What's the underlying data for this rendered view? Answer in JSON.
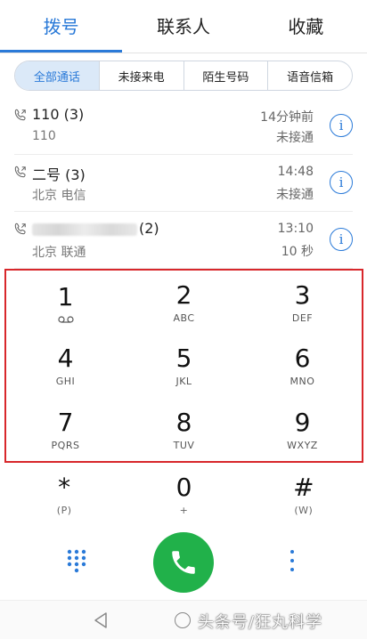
{
  "tabs": [
    {
      "label": "拨号",
      "active": true
    },
    {
      "label": "联系人",
      "active": false
    },
    {
      "label": "收藏",
      "active": false
    }
  ],
  "filters": [
    {
      "label": "全部通话",
      "active": true
    },
    {
      "label": "未接来电",
      "active": false
    },
    {
      "label": "陌生号码",
      "active": false
    },
    {
      "label": "语音信箱",
      "active": false
    }
  ],
  "calls": [
    {
      "name": "110 (3)",
      "sub": "110",
      "time": "14分钟前",
      "status": "未接通"
    },
    {
      "name": "二号 (3)",
      "sub": "北京 电信",
      "time": "14:48",
      "status": "未接通"
    },
    {
      "name": "(2)",
      "sub": "北京 联通",
      "time": "13:10",
      "status": "10 秒"
    }
  ],
  "keypad": [
    {
      "digit": "1",
      "letters": ""
    },
    {
      "digit": "2",
      "letters": "ABC"
    },
    {
      "digit": "3",
      "letters": "DEF"
    },
    {
      "digit": "4",
      "letters": "GHI"
    },
    {
      "digit": "5",
      "letters": "JKL"
    },
    {
      "digit": "6",
      "letters": "MNO"
    },
    {
      "digit": "7",
      "letters": "PQRS"
    },
    {
      "digit": "8",
      "letters": "TUV"
    },
    {
      "digit": "9",
      "letters": "WXYZ"
    }
  ],
  "bottom_keys": [
    {
      "digit": "*",
      "letters": "(P)"
    },
    {
      "digit": "0",
      "letters": "+"
    },
    {
      "digit": "#",
      "letters": "(W)"
    }
  ],
  "info_glyph": "i",
  "watermark": "头条号/狂丸科学",
  "colors": {
    "accent": "#2a7ad8",
    "call_green": "#21b14a",
    "highlight_red": "#d8272b"
  }
}
